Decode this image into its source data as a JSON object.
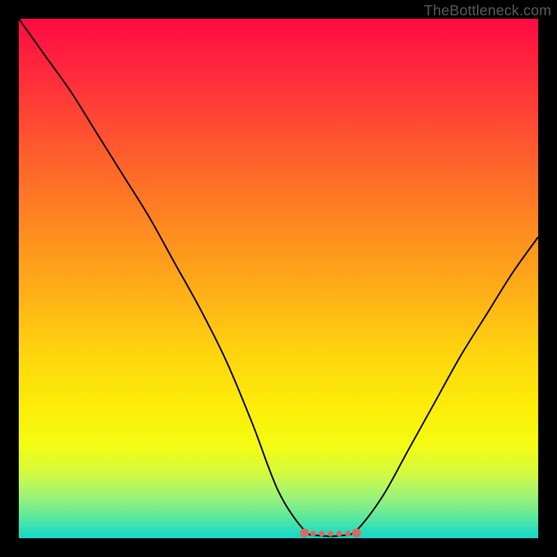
{
  "watermark": "TheBottleneck.com",
  "colors": {
    "frame": "#000000",
    "curve": "#000000",
    "marker": "#d86a64",
    "gradient_top": "#ff0a44",
    "gradient_bottom": "#17d9c8"
  },
  "chart_data": {
    "type": "line",
    "title": "",
    "xlabel": "",
    "ylabel": "",
    "xlim": [
      0,
      100
    ],
    "ylim": [
      0,
      100
    ],
    "background": "vertical-gradient red-orange-yellow-green (green compressed at bottom)",
    "series": [
      {
        "name": "bottleneck-curve",
        "x": [
          0,
          5,
          10,
          15,
          20,
          25,
          30,
          35,
          40,
          45,
          50,
          55,
          58,
          62,
          65,
          70,
          75,
          80,
          85,
          90,
          95,
          100
        ],
        "values": [
          100,
          93,
          86,
          78,
          70,
          62,
          53,
          44,
          34,
          22,
          9,
          1.5,
          0.5,
          0.5,
          1.5,
          8,
          17,
          26,
          35,
          43,
          51,
          58
        ]
      }
    ],
    "annotations": [
      {
        "name": "flat-minimum-segment",
        "style": "thick-pink-dotted",
        "x_start": 55,
        "x_end": 65,
        "y": 1
      }
    ]
  }
}
